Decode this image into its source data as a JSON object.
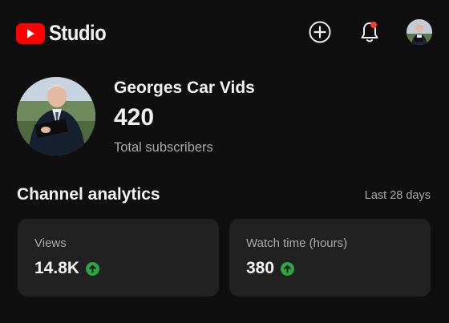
{
  "app": {
    "logo_text": "Studio",
    "brand_color": "#ff0000"
  },
  "header": {
    "create_icon": "plus-circle-icon",
    "notifications_icon": "bell-icon",
    "notification_badge": true,
    "account_icon": "account-avatar"
  },
  "channel": {
    "name": "Georges Car Vids",
    "subscriber_count": "420",
    "subscriber_label": "Total subscribers"
  },
  "analytics": {
    "title": "Channel analytics",
    "period": "Last 28 days",
    "cards": [
      {
        "label": "Views",
        "value": "14.8K",
        "trend": "up"
      },
      {
        "label": "Watch time (hours)",
        "value": "380",
        "trend": "up"
      }
    ],
    "trend_color": "#2ba640"
  }
}
